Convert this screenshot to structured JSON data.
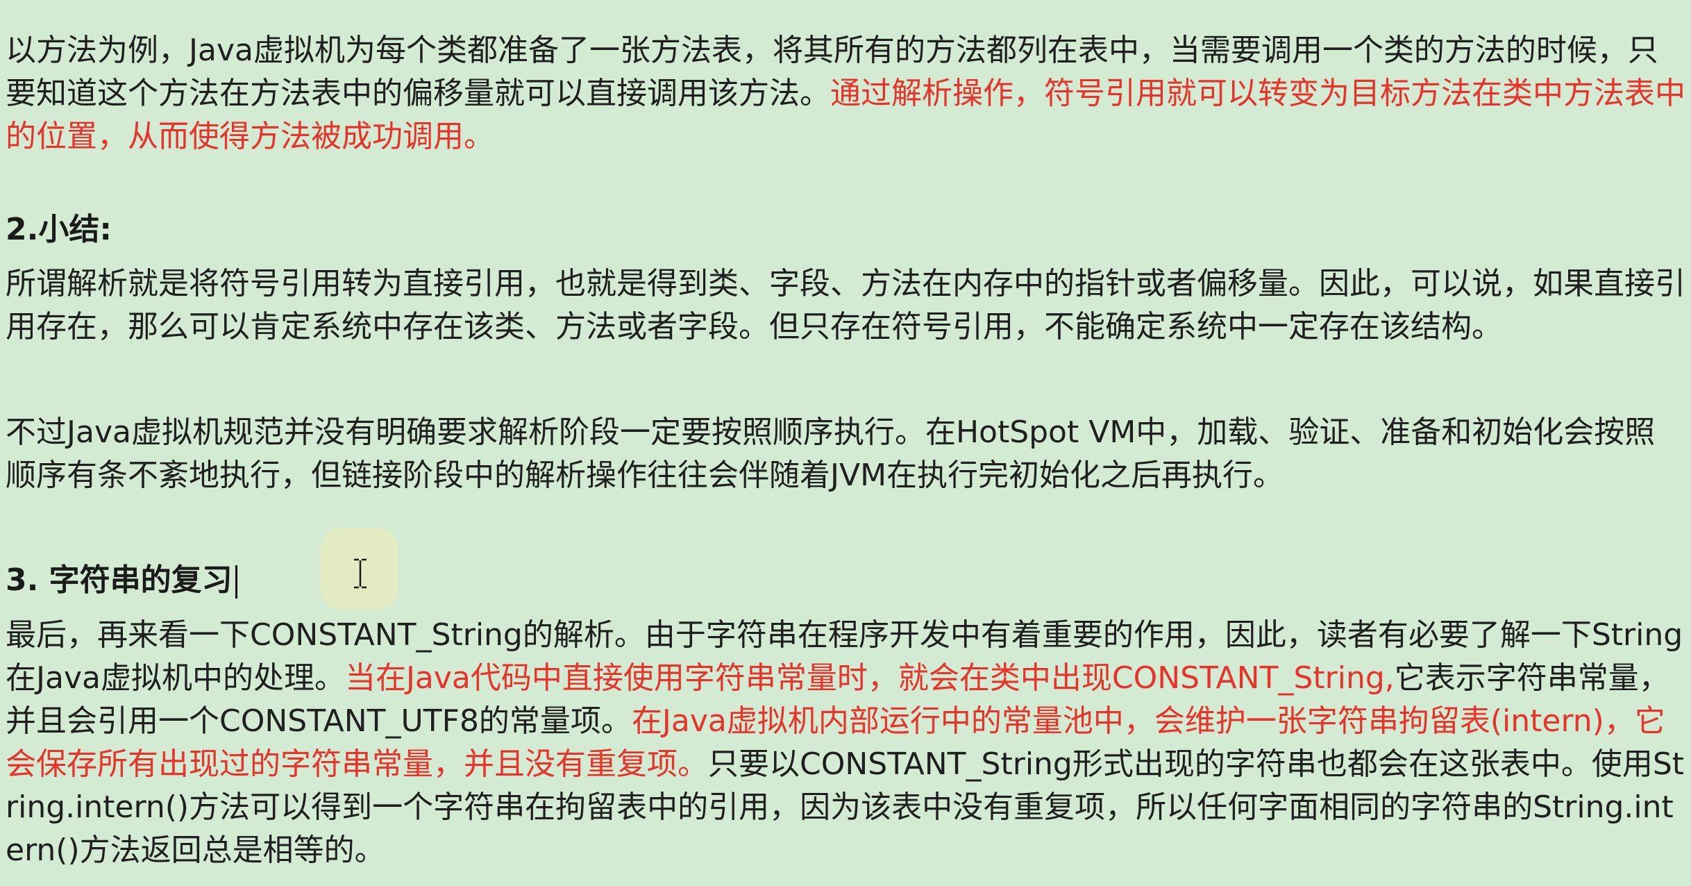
{
  "document": {
    "p1": {
      "normal": "以方法为例，Java虚拟机为每个类都准备了一张方法表，将其所有的方法都列在表中，当需要调用一个类的方法的时候，只要知道这个方法在方法表中的偏移量就可以直接调用该方法。",
      "red": "通过解析操作，符号引用就可以转变为目标方法在类中方法表中的位置，从而使得方法被成功调用。"
    },
    "h2": "2.小结:",
    "p2": "所谓解析就是将符号引用转为直接引用，也就是得到类、字段、方法在内存中的指针或者偏移量。因此，可以说，如果直接引用存在，那么可以肯定系统中存在该类、方法或者字段。但只存在符号引用，不能确定系统中一定存在该结构。",
    "p3": "不过Java虚拟机规范并没有明确要求解析阶段一定要按照顺序执行。在HotSpot VM中，加载、验证、准备和初始化会按照顺序有条不紊地执行，但链接阶段中的解析操作往往会伴随着JVM在执行完初始化之后再执行。",
    "h3": "3. 字符串的复习",
    "p4": {
      "s1": "最后，再来看一下CONSTANT_String的解析。由于字符串在程序开发中有着重要的作用，因此，读者有必要了解一下String在Java虚拟机中的处理。",
      "r1": "当在Java代码中直接使用字符串常量时，就会在类中出现CONSTANT_String,",
      "s2": "它表示字符串常量，并且会引用一个CONSTANT_UTF8的常量项。",
      "r2": "在Java虚拟机内部运行中的常量池中，会维护一张字符串拘留表(intern)，它会保存所有出现过的字符串常量，并且没有重复项。",
      "s3": "只要以CONSTANT_String形式出现的字符串也都会在这张表中。使用String.intern()方法可以得到一个字符串在拘留表中的引用，因为该表中没有重复项，所以任何字面相同的字符串的String.intern()方法返回总是相等的。"
    }
  },
  "colors": {
    "background": "#d2ebd2",
    "text": "#1f1f1f",
    "highlight_red": "#e8332a"
  },
  "icons": {
    "cursor": "text-cursor-ibeam"
  }
}
